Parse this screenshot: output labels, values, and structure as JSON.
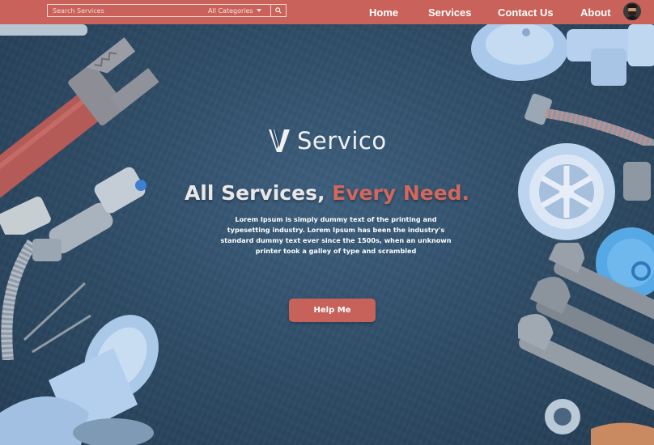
{
  "header": {
    "search": {
      "placeholder": "Search Services",
      "category": "All Categories"
    },
    "nav": [
      {
        "label": "Home"
      },
      {
        "label": "Services"
      },
      {
        "label": "Contact Us"
      },
      {
        "label": "About"
      }
    ]
  },
  "hero": {
    "brand": "Servico",
    "headline_white": "All Services, ",
    "headline_accent": "Every Need.",
    "description": "Lorem Ipsum is simply dummy text of the printing and typesetting industry. Lorem Ipsum has been the industry's standard dummy text ever since the 1500s, when an unknown printer took a galley of type and scrambled",
    "cta": "Help Me"
  },
  "colors": {
    "accent": "#c9625a",
    "background": "#2f4c66",
    "tool_blue": "#a9c6e6"
  }
}
